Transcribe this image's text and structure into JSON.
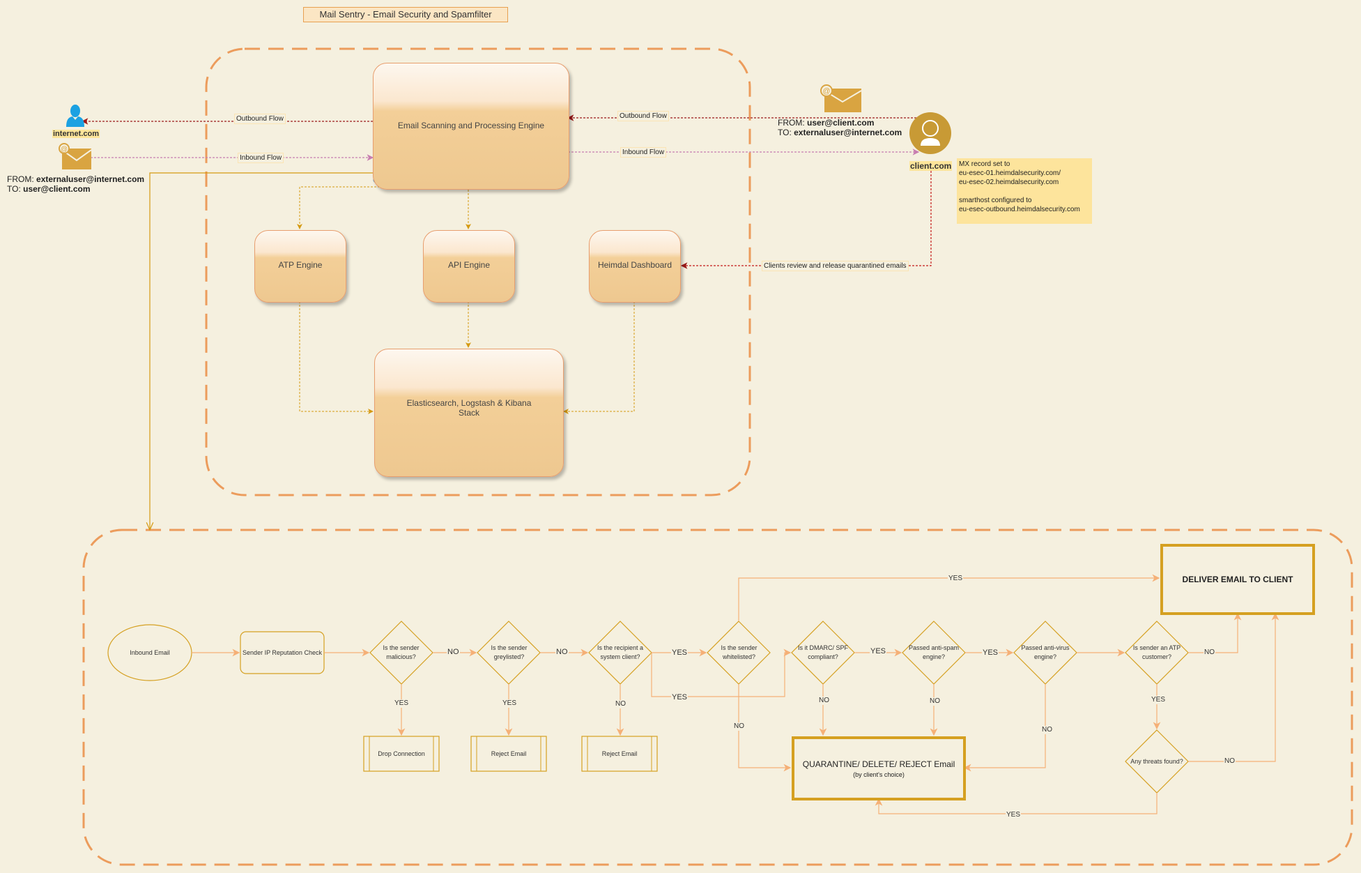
{
  "title": "Mail Sentry - Email Security and Spamfilter",
  "colors": {
    "background": "#f5f0df",
    "container_dash": "#ec9c5c",
    "outbound_line": "#9c1a1a",
    "inbound_line": "#c87db0",
    "internal_line": "#d59a12",
    "flow_line": "#f5b077",
    "decision_border": "#d5a021",
    "user_icon_internet": "#1ba1e2",
    "user_icon_client": "#c89a35",
    "mail_icon": "#d9a441",
    "magnifier": "#3e8ed0",
    "note_bg": "#fde49c"
  },
  "architecture": {
    "internet": {
      "label": "internet.com",
      "icon": "user-icon",
      "mail_icon": "email-icon",
      "from_label": "FROM:",
      "from_value": "externaluser@internet.com",
      "to_label": "TO:",
      "to_value": "user@client.com"
    },
    "client": {
      "label": "client.com",
      "icon": "user-circle-icon",
      "mail_icon": "email-icon",
      "from_label": "FROM:",
      "from_value": "user@client.com",
      "to_label": "TO:",
      "to_value": "externaluser@internet.com",
      "note_lines": [
        "MX record set to",
        "eu-esec-01.heimdalsecurity.com/",
        "eu-esec-02.heimdalsecurity.com",
        "",
        "smarthost configured to",
        "eu-esec-outbound.heimdalsecurity.com"
      ]
    },
    "nodes": {
      "engine": "Email Scanning and Processing Engine",
      "atp": "ATP Engine",
      "api": "API Engine",
      "dashboard": "Heimdal Dashboard",
      "elk_line1": "Elasticsearch, Logstash & Kibana",
      "elk_line2": "Stack"
    },
    "edges": {
      "outbound_left": "Outbound Flow",
      "inbound_left": "Inbound Flow",
      "outbound_right": "Outbound Flow",
      "inbound_right": "Inbound Flow",
      "quarantine_review": "Clients review and release quarantined emails"
    }
  },
  "flowchart": {
    "start": "Inbound Email",
    "reputation": "Sender IP Reputation Check",
    "decisions": {
      "malicious": "Is the sender malicious?",
      "greylisted": "Is the sender greylisted?",
      "system_client": "Is the recipient a system client?",
      "whitelisted": "Is the sender whitelisted?",
      "dmarc": "Is it DMARC/ SPF compliant?",
      "antispam": "Passed anti-spam engine?",
      "antivirus": "Passed anti-virus engine?",
      "atp_customer": "Is sender an ATP customer?",
      "threats": "Any threats found?"
    },
    "actions": {
      "drop": "Drop Connection",
      "reject1": "Reject Email",
      "reject2": "Reject Email",
      "deliver": "DELIVER EMAIL TO CLIENT",
      "quarantine": "QUARANTINE/ DELETE/ REJECT Email",
      "quarantine_sub": "(by client's choice)"
    },
    "edge_labels": {
      "malicious_no": "NO",
      "malicious_yes": "YES",
      "greylisted_no": "NO",
      "greylisted_yes": "YES",
      "system_yes": "YES",
      "system_yes2": "YES",
      "system_no": "NO",
      "whitelisted_yes": "YES",
      "whitelisted_no": "NO",
      "dmarc_yes": "YES",
      "dmarc_no": "NO",
      "antispam_yes": "YES",
      "antispam_no": "NO",
      "antivirus_no": "NO",
      "atp_no": "NO",
      "atp_yes": "YES",
      "threats_no": "NO",
      "threats_yes": "YES"
    }
  }
}
